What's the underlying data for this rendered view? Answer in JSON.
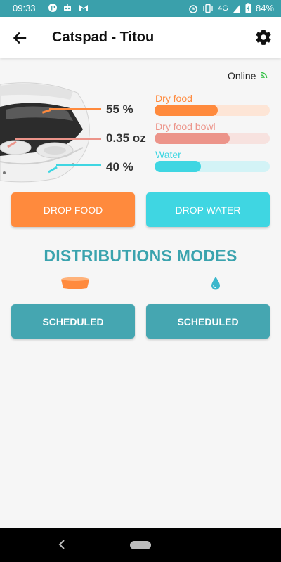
{
  "status_bar": {
    "time": "09:33",
    "network": "4G",
    "battery": "84%"
  },
  "header": {
    "title": "Catspad - Titou",
    "back_icon": "arrow-left-icon",
    "settings_icon": "gear-icon"
  },
  "connection": {
    "status": "Online",
    "icon": "wifi-signal-icon",
    "color": "#39c24a"
  },
  "device_readings": {
    "dry_food_pct": "55 %",
    "bowl_weight": "0.35 oz",
    "water_pct": "40 %"
  },
  "gauges": [
    {
      "label": "Dry food",
      "level": 0.55,
      "color": "#ff8a3d",
      "track": "#fde5d6"
    },
    {
      "label": "Dry food bowl",
      "level": 0.65,
      "color": "#ec948a",
      "track": "#f7e2df"
    },
    {
      "label": "Water",
      "level": 0.4,
      "color": "#3fd6e2",
      "track": "#d3f3f6"
    }
  ],
  "actions": {
    "drop_food": "DROP FOOD",
    "drop_water": "DROP WATER"
  },
  "modes": {
    "title": "DISTRIBUTIONS MODES",
    "food_icon": "food-bowl-icon",
    "water_icon": "water-drop-icon",
    "food_mode": "SCHEDULED",
    "water_mode": "SCHEDULED"
  },
  "colors": {
    "primary": "#3aa3ae",
    "food": "#ff8a3d",
    "water": "#3fd6e2"
  }
}
